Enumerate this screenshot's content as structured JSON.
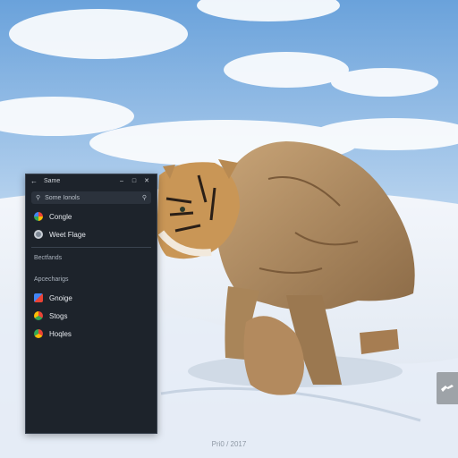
{
  "panel": {
    "title": "Same",
    "search_placeholder": "Some Ionols",
    "items_top": [
      {
        "label": "Congle",
        "icon": "google-icon"
      },
      {
        "label": "Weet Flage",
        "icon": "settings-icon"
      }
    ],
    "section1": "Bectfands",
    "section2": "Apcecharigs",
    "items_bottom": [
      {
        "label": "Gnoige",
        "icon": "doc-icon"
      },
      {
        "label": "Stogs",
        "icon": "chrome-icon"
      },
      {
        "label": "Hoqles",
        "icon": "chrome-icon"
      }
    ]
  },
  "caption": "Pri0 / 2017",
  "colors": {
    "panel_bg": "#1d232b",
    "sky": "#7fb0e0",
    "snow": "#eef3fa"
  }
}
